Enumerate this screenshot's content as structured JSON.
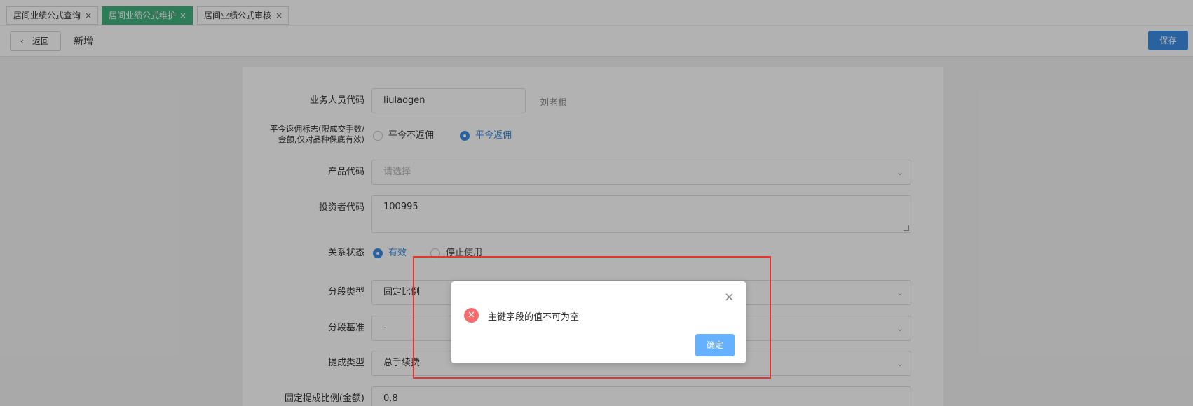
{
  "tabs": [
    {
      "label": "居间业绩公式查询",
      "active": false
    },
    {
      "label": "居间业绩公式维护",
      "active": true
    },
    {
      "label": "居间业绩公式审核",
      "active": false
    }
  ],
  "tab_close_glyph": "×",
  "toolbar": {
    "back_label": "返回",
    "page_title": "新增",
    "save_label": "保存"
  },
  "form": {
    "staff_code": {
      "label": "业务人员代码",
      "value": "liulaogen",
      "helper": "刘老根"
    },
    "return_flag": {
      "label_line1": "平今返佣标志(限成交手数/",
      "label_line2": "金额,仅对品种保底有效)",
      "options": [
        {
          "label": "平今不返佣",
          "selected": false
        },
        {
          "label": "平今返佣",
          "selected": true
        }
      ]
    },
    "product_code": {
      "label": "产品代码",
      "placeholder": "请选择"
    },
    "investor_code": {
      "label": "投资者代码",
      "value": "100995"
    },
    "relation_status": {
      "label": "关系状态",
      "options": [
        {
          "label": "有效",
          "selected": true
        },
        {
          "label": "停止使用",
          "selected": false
        }
      ]
    },
    "segment_type": {
      "label": "分段类型",
      "value": "固定比例"
    },
    "segment_base": {
      "label": "分段基准",
      "value": "-"
    },
    "commission_type": {
      "label": "提成类型",
      "value": "总手续费"
    },
    "fixed_ratio": {
      "label": "固定提成比例(金额)",
      "value": "0.8"
    }
  },
  "dialog": {
    "message": "主键字段的值不可为空",
    "ok_label": "确定",
    "close_glyph": "×",
    "error_glyph": "✕"
  },
  "colors": {
    "active_tab": "#3fb27f",
    "primary": "#3a8ee6",
    "error": "#f56c6c",
    "highlight": "#e3342f"
  }
}
